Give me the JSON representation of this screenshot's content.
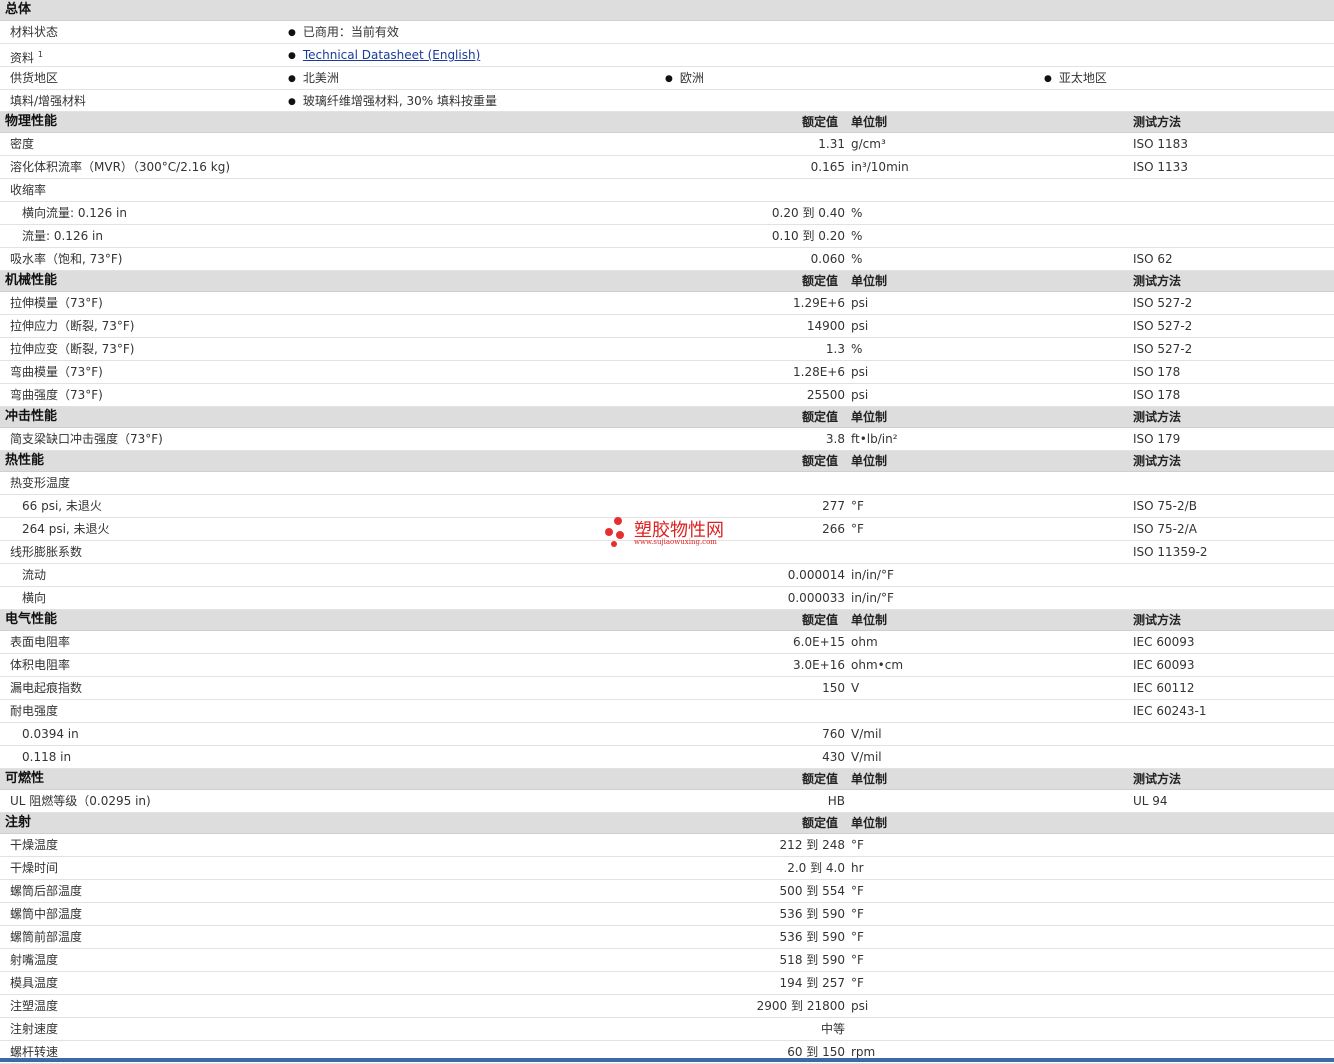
{
  "headers": {
    "nominal": "额定值",
    "unit": "单位制",
    "test": "测试方法"
  },
  "general": {
    "title": "总体",
    "status_label": "材料状态",
    "status_value": "已商用：当前有效",
    "docs_label": "资料",
    "docs_sup": "1",
    "docs_link": "Technical Datasheet (English)",
    "supply_label": "供货地区",
    "supply_values": [
      "北美洲",
      "欧洲",
      "亚太地区"
    ],
    "filler_label": "填料/增强材料",
    "filler_value": "玻璃纤维增强材料, 30% 填料按重量"
  },
  "sections": [
    {
      "title": "物理性能",
      "show_test": true,
      "rows": [
        {
          "label": "密度",
          "value": "1.31",
          "unit": "g/cm³",
          "test": "ISO 1183"
        },
        {
          "label": "溶化体积流率（MVR）（300°C/2.16 kg)",
          "value": "0.165",
          "unit": "in³/10min",
          "test": "ISO 1133"
        },
        {
          "label": "收缩率",
          "value": "",
          "unit": "",
          "test": ""
        },
        {
          "label": "横向流量: 0.126 in",
          "sub": true,
          "value": "0.20 到 0.40",
          "unit": "%",
          "test": ""
        },
        {
          "label": "流量: 0.126 in",
          "sub": true,
          "value": "0.10 到 0.20",
          "unit": "%",
          "test": ""
        },
        {
          "label": "吸水率（饱和, 73°F)",
          "value": "0.060",
          "unit": "%",
          "test": "ISO 62"
        }
      ]
    },
    {
      "title": "机械性能",
      "show_test": true,
      "rows": [
        {
          "label": "拉伸模量（73°F)",
          "value": "1.29E+6",
          "unit": "psi",
          "test": "ISO 527-2"
        },
        {
          "label": "拉伸应力（断裂, 73°F)",
          "value": "14900",
          "unit": "psi",
          "test": "ISO 527-2"
        },
        {
          "label": "拉伸应变（断裂, 73°F)",
          "value": "1.3",
          "unit": "%",
          "test": "ISO 527-2"
        },
        {
          "label": "弯曲模量（73°F)",
          "value": "1.28E+6",
          "unit": "psi",
          "test": "ISO 178"
        },
        {
          "label": "弯曲强度（73°F)",
          "value": "25500",
          "unit": "psi",
          "test": "ISO 178"
        }
      ]
    },
    {
      "title": "冲击性能",
      "show_test": true,
      "rows": [
        {
          "label": "简支梁缺口冲击强度（73°F)",
          "value": "3.8",
          "unit": "ft•lb/in²",
          "test": "ISO 179"
        }
      ]
    },
    {
      "title": "热性能",
      "show_test": true,
      "rows": [
        {
          "label": "热变形温度",
          "value": "",
          "unit": "",
          "test": ""
        },
        {
          "label": "66 psi, 未退火",
          "sub": true,
          "value": "277",
          "unit": "°F",
          "test": "ISO 75-2/B"
        },
        {
          "label": "264 psi, 未退火",
          "sub": true,
          "value": "266",
          "unit": "°F",
          "test": "ISO 75-2/A"
        },
        {
          "label": "线形膨胀系数",
          "value": "",
          "unit": "",
          "test": "ISO 11359-2"
        },
        {
          "label": "流动",
          "sub": true,
          "value": "0.000014",
          "unit": "in/in/°F",
          "test": ""
        },
        {
          "label": "横向",
          "sub": true,
          "value": "0.000033",
          "unit": "in/in/°F",
          "test": ""
        }
      ]
    },
    {
      "title": "电气性能",
      "show_test": true,
      "rows": [
        {
          "label": "表面电阻率",
          "value": "6.0E+15",
          "unit": "ohm",
          "test": "IEC 60093"
        },
        {
          "label": "体积电阻率",
          "value": "3.0E+16",
          "unit": "ohm•cm",
          "test": "IEC 60093"
        },
        {
          "label": "漏电起痕指数",
          "value": "150",
          "unit": "V",
          "test": "IEC 60112"
        },
        {
          "label": "耐电强度",
          "value": "",
          "unit": "",
          "test": "IEC 60243-1"
        },
        {
          "label": "0.0394 in",
          "sub": true,
          "value": "760",
          "unit": "V/mil",
          "test": ""
        },
        {
          "label": "0.118 in",
          "sub": true,
          "value": "430",
          "unit": "V/mil",
          "test": ""
        }
      ]
    },
    {
      "title": "可燃性",
      "show_test": true,
      "rows": [
        {
          "label": "UL 阻燃等级（0.0295 in)",
          "value": "HB",
          "unit": "",
          "test": "UL 94"
        }
      ]
    },
    {
      "title": "注射",
      "show_test": false,
      "rows": [
        {
          "label": "干燥温度",
          "value": "212 到 248",
          "unit": "°F",
          "test": ""
        },
        {
          "label": "干燥时间",
          "value": "2.0 到 4.0",
          "unit": "hr",
          "test": ""
        },
        {
          "label": "螺筒后部温度",
          "value": "500 到 554",
          "unit": "°F",
          "test": ""
        },
        {
          "label": "螺筒中部温度",
          "value": "536 到 590",
          "unit": "°F",
          "test": ""
        },
        {
          "label": "螺筒前部温度",
          "value": "536 到 590",
          "unit": "°F",
          "test": ""
        },
        {
          "label": "射嘴温度",
          "value": "518 到 590",
          "unit": "°F",
          "test": ""
        },
        {
          "label": "模具温度",
          "value": "194 到 257",
          "unit": "°F",
          "test": ""
        },
        {
          "label": "注塑温度",
          "value": "2900 到 21800",
          "unit": "psi",
          "test": ""
        },
        {
          "label": "注射速度",
          "value": "中等",
          "unit": "",
          "test": ""
        },
        {
          "label": "螺杆转速",
          "value": "60 到 150",
          "unit": "rpm",
          "test": ""
        }
      ]
    }
  ],
  "watermark": {
    "text": "塑胶物性网",
    "url": "www.sujiaowuxing.com"
  }
}
